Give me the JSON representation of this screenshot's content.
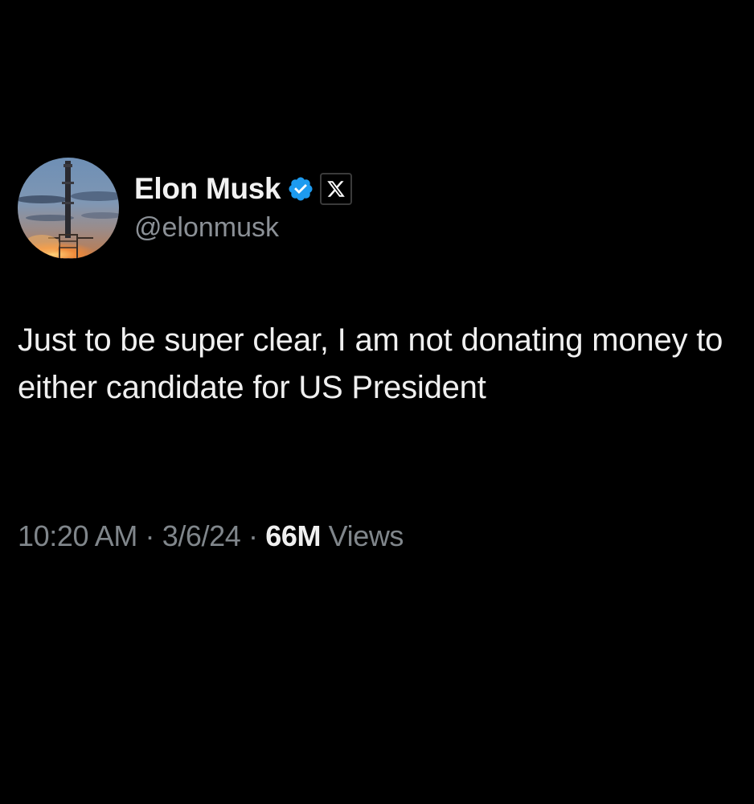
{
  "author": {
    "display_name": "Elon Musk",
    "handle": "@elonmusk",
    "verified_badge_color": "#1d9bf0",
    "affiliate_badge_icon": "x-logo-icon",
    "avatar_icon": "starship-launch-avatar"
  },
  "tweet": {
    "text": "Just to be super clear, I am not donating money to either candidate for US President"
  },
  "meta": {
    "time": "10:20 AM",
    "separator_1": " · ",
    "date": "3/6/24",
    "separator_2": " · ",
    "views_count": "66M",
    "views_label": " Views"
  },
  "colors": {
    "background": "#000000",
    "primary_text": "#f0f0f0",
    "secondary_text": "#80868b",
    "accent": "#1d9bf0"
  }
}
